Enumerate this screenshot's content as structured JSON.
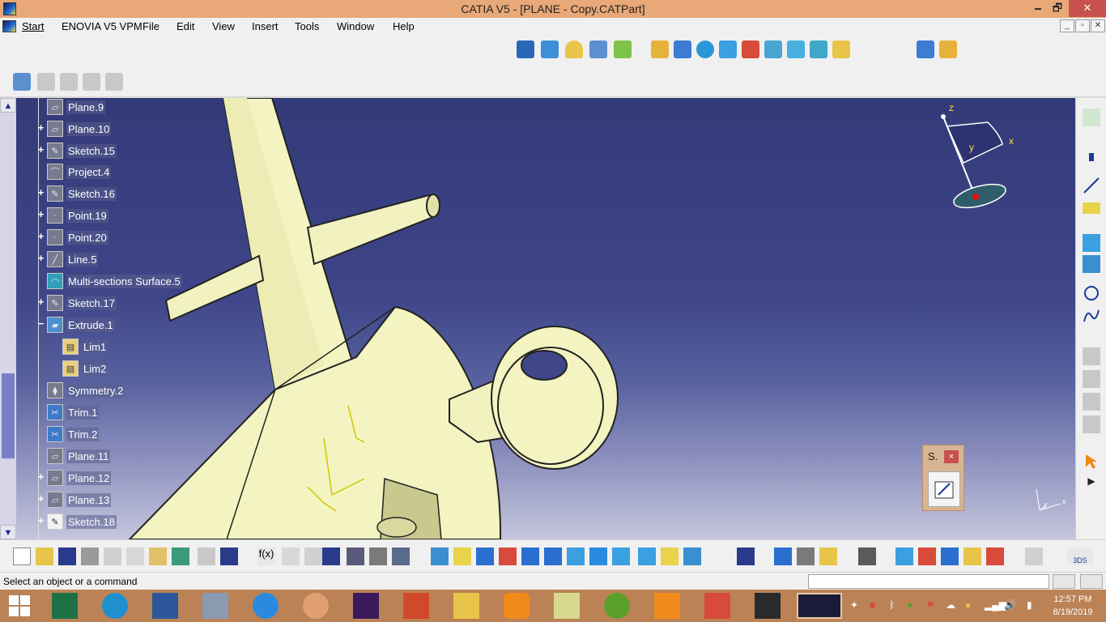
{
  "window": {
    "title": "CATIA V5 - [PLANE - Copy.CATPart]",
    "minimize": "🗕",
    "restore": "🗗",
    "close": "✕"
  },
  "menu": {
    "start": "Start",
    "enovia": "ENOVIA V5 VPM",
    "file": "File",
    "edit": "Edit",
    "view": "View",
    "insert": "Insert",
    "tools": "Tools",
    "window": "Window",
    "help": "Help"
  },
  "mdi": {
    "minimize": "_",
    "restore": "▫",
    "close": "✕"
  },
  "tree": {
    "nodes": [
      {
        "label": "Plane.9",
        "icon": "plane-icon"
      },
      {
        "label": "Plane.10",
        "icon": "plane-icon"
      },
      {
        "label": "Sketch.15",
        "icon": "sketch-icon"
      },
      {
        "label": "Project.4",
        "icon": "project-icon"
      },
      {
        "label": "Sketch.16",
        "icon": "sketch-icon"
      },
      {
        "label": "Point.19",
        "icon": "point-icon"
      },
      {
        "label": "Point.20",
        "icon": "point-icon"
      },
      {
        "label": "Line.5",
        "icon": "line-icon"
      },
      {
        "label": "Multi-sections Surface.5",
        "icon": "surface-icon"
      },
      {
        "label": "Sketch.17",
        "icon": "sketch-icon"
      },
      {
        "label": "Extrude.1",
        "icon": "extrude-icon"
      },
      {
        "label": "Lim1",
        "icon": "limit-icon"
      },
      {
        "label": "Lim2",
        "icon": "limit-icon"
      },
      {
        "label": "Symmetry.2",
        "icon": "symmetry-icon"
      },
      {
        "label": "Trim.1",
        "icon": "trim-icon"
      },
      {
        "label": "Trim.2",
        "icon": "trim-icon"
      },
      {
        "label": "Plane.11",
        "icon": "plane-icon"
      },
      {
        "label": "Plane.12",
        "icon": "plane-icon"
      },
      {
        "label": "Plane.13",
        "icon": "plane-icon"
      },
      {
        "label": "Sketch.18",
        "icon": "sketch-icon"
      }
    ]
  },
  "compass": {
    "z": "z",
    "x": "x",
    "y": "y"
  },
  "axis_triad": {
    "y": "y",
    "x": "x"
  },
  "sketcher_toolbar": {
    "title": "S.",
    "close": "×"
  },
  "status": {
    "message": "Select an object or a command"
  },
  "clock": {
    "time": "12:57 PM",
    "date": "8/19/2019"
  },
  "colors": {
    "title_bar": "#e9a877",
    "taskbar": "#bb8256",
    "viewport_top": "#333a78",
    "part": "#f5f5c6",
    "close_red": "#c7514d"
  }
}
